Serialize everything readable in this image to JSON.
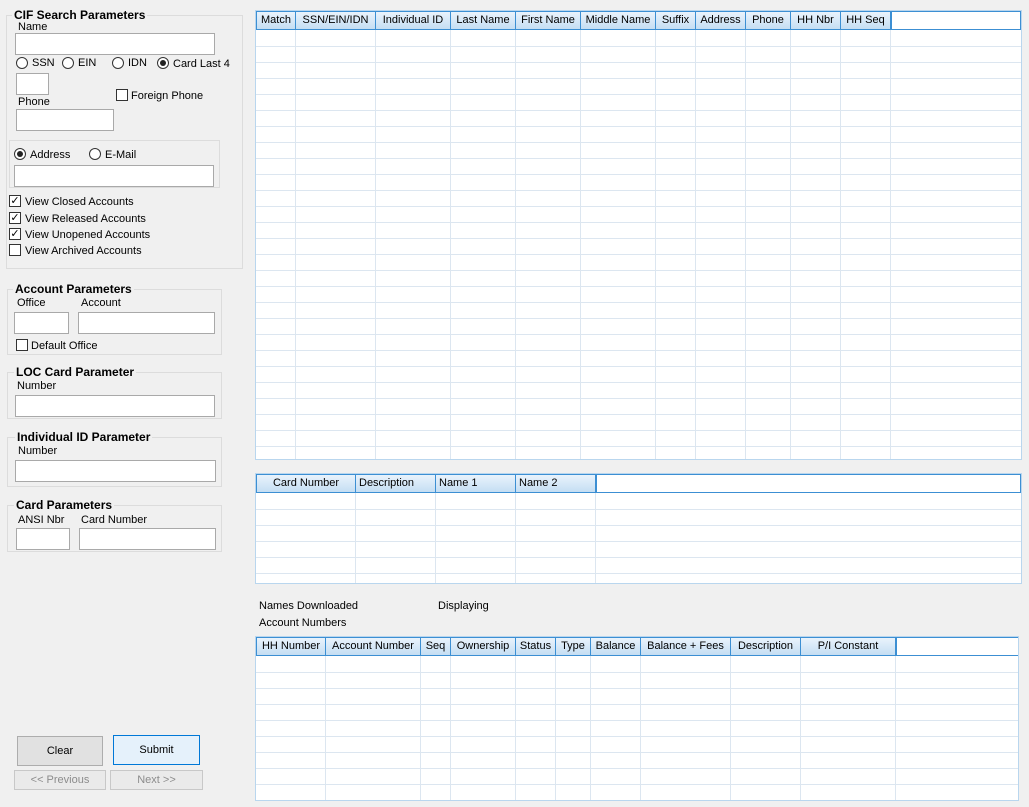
{
  "cif": {
    "title": "CIF Search Parameters",
    "name_label": "Name",
    "radios": [
      "SSN",
      "EIN",
      "IDN",
      "Card Last 4"
    ],
    "selected_radio": "Card Last 4",
    "phone_label": "Phone",
    "foreign_phone": "Foreign Phone",
    "address_radio": "Address",
    "email_radio": "E-Mail",
    "checkboxes": [
      {
        "label": "View Closed Accounts",
        "checked": true
      },
      {
        "label": "View Released Accounts",
        "checked": true
      },
      {
        "label": "View Unopened Accounts",
        "checked": true
      },
      {
        "label": "View Archived Accounts",
        "checked": false
      }
    ]
  },
  "account": {
    "title": "Account Parameters",
    "office_label": "Office",
    "account_label": "Account",
    "default_office": "Default Office"
  },
  "loc": {
    "title": "LOC Card Parameter",
    "number_label": "Number"
  },
  "individual": {
    "title": "Individual ID Parameter",
    "number_label": "Number"
  },
  "card": {
    "title": "Card Parameters",
    "ansi_label": "ANSI Nbr",
    "card_number_label": "Card Number"
  },
  "buttons": {
    "clear": "Clear",
    "submit": "Submit",
    "previous": "<< Previous",
    "next": "Next >>"
  },
  "grid1": {
    "columns": [
      "Match",
      "SSN/EIN/IDN",
      "Individual ID",
      "Last Name",
      "First Name",
      "Middle Name",
      "Suffix",
      "Address",
      "Phone",
      "HH Nbr",
      "HH Seq"
    ]
  },
  "grid2": {
    "columns": [
      "Card Number",
      "Description",
      "Name 1",
      "Name 2"
    ]
  },
  "status": {
    "names_downloaded": "Names Downloaded",
    "displaying": "Displaying",
    "account_numbers": "Account Numbers"
  },
  "grid3": {
    "columns": [
      "HH Number",
      "Account Number",
      "Seq",
      "Ownership",
      "Status",
      "Type",
      "Balance",
      "Balance + Fees",
      "Description",
      "P/I Constant"
    ]
  }
}
